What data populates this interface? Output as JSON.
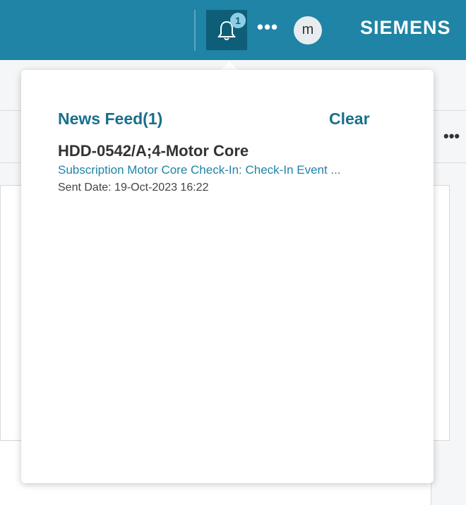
{
  "topbar": {
    "notification_count": "1",
    "more_label": "•••",
    "avatar_initial": "m",
    "brand": "SIEMENS",
    "colors": {
      "bar": "#1f84a6",
      "active_button": "#0f5e78"
    }
  },
  "background": {
    "more_label": "•••"
  },
  "news_feed": {
    "title": "News Feed(1)",
    "clear_label": "Clear",
    "items": [
      {
        "title": "HDD-0542/A;4-Motor Core",
        "description": "Subscription Motor Core Check-In: Check-In Event ...",
        "sent_date": "Sent Date: 19-Oct-2023 16:22"
      }
    ]
  },
  "icons": {
    "notification": "bell-icon"
  }
}
